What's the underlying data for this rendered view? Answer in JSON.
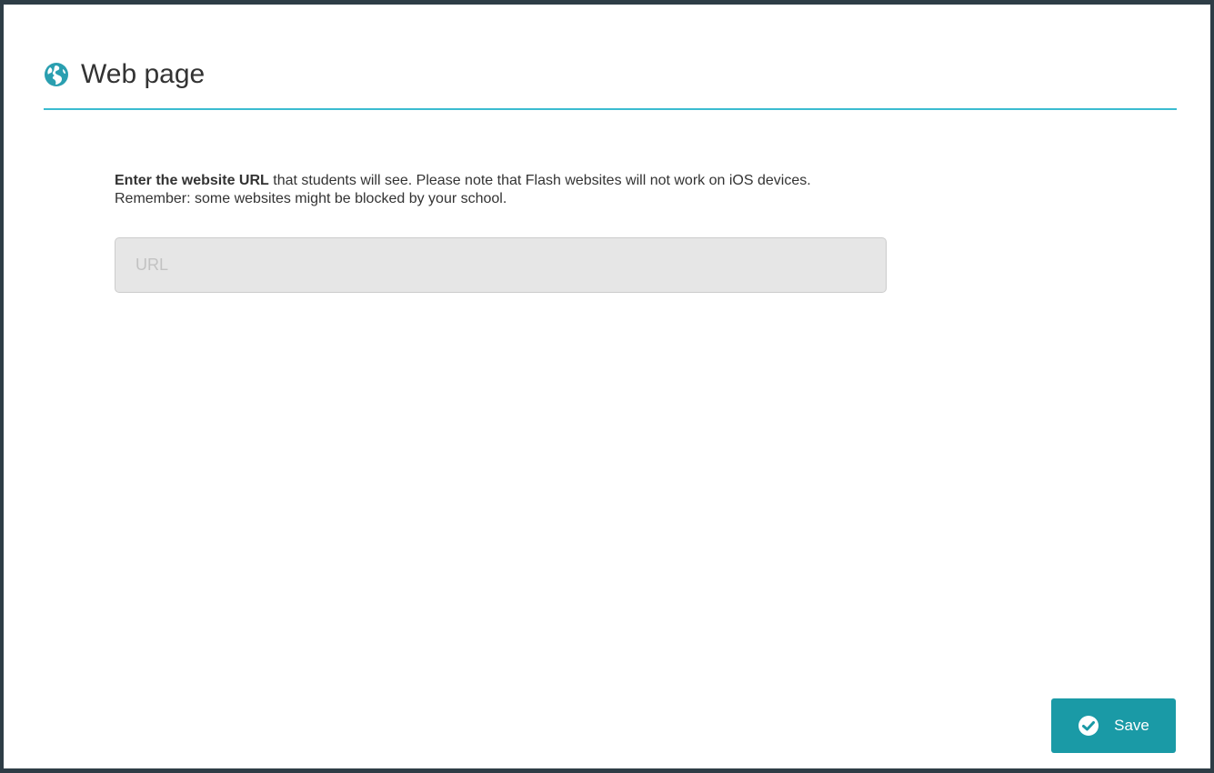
{
  "dialog": {
    "title": "Web page",
    "icon": "globe-icon",
    "accent_color": "#3bbcd0"
  },
  "description": {
    "bold_text": "Enter the website URL",
    "rest_line1": " that students will see. Please note that Flash websites will not work on iOS devices.",
    "line2": "Remember: some websites might be blocked by your school."
  },
  "url_field": {
    "value": "",
    "placeholder": "URL"
  },
  "footer": {
    "save_label": "Save",
    "save_icon": "check-circle-icon",
    "button_color": "#1a9aa6"
  }
}
